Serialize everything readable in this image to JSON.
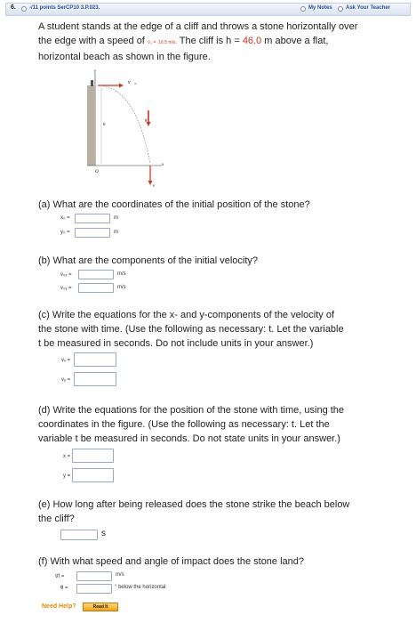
{
  "header": {
    "number": "6.",
    "points": "-/11 points  SerCP10 3.P.023.",
    "my_notes": "My Notes",
    "ask_teacher": "Ask Your Teacher"
  },
  "problem": {
    "line1": "A student stands at the edge of a cliff and throws a stone horizontally over",
    "line2_pre": "the edge with a speed of ",
    "v0_symbol": "v⃗₀ =",
    "v0_value": "16.5 m/s.",
    "line2_post": " The cliff is h = ",
    "h_value": "46.0",
    "line2_end": " m above a flat,",
    "line3": "horizontal beach as shown in the figure."
  },
  "figure": {
    "v0_label": "v⃗₀",
    "g_label": "g⃗",
    "h_label": "h",
    "origin_label": "O",
    "x_label": "x",
    "y_label": "y",
    "v_label": "v⃗"
  },
  "part_a": {
    "question": "(a) What are the coordinates of the initial position of the stone?",
    "x_label": "x₀ =",
    "y_label": "y₀ =",
    "x_unit": "m",
    "y_unit": "m"
  },
  "part_b": {
    "question": "(b) What are the components of the initial velocity?",
    "x_label": "v₀ₓ =",
    "y_label": "v₀ᵧ =",
    "x_unit": "m/s",
    "y_unit": "m/s"
  },
  "part_c": {
    "line1": "(c) Write the equations for the x- and y-components of the velocity of",
    "line2": "the stone with time. (Use the following as necessary: t. Let the variable",
    "line3": "t be measured in seconds. Do not include units in your answer.)",
    "x_label": "vₓ =",
    "y_label": "vᵧ ="
  },
  "part_d": {
    "line1": "(d) Write the equations for the position of the stone with time, using the",
    "line2": "coordinates in the figure. (Use the following as necessary: t. Let the",
    "line3": "variable t be measured in seconds. Do not state units in your answer.)",
    "x_label": "x =",
    "y_label": "y ="
  },
  "part_e": {
    "line1": "(e) How long after being released does the stone strike the beach below",
    "line2": "the cliff?",
    "unit": "s"
  },
  "part_f": {
    "question": "(f) With what speed and angle of impact does the stone land?",
    "v_label": "v⃗f =",
    "theta_label": "θ =",
    "v_unit": "m/s",
    "theta_unit": "° below the horizontal"
  },
  "help": {
    "need_help": "Need Help?",
    "read_it": "Read It"
  }
}
